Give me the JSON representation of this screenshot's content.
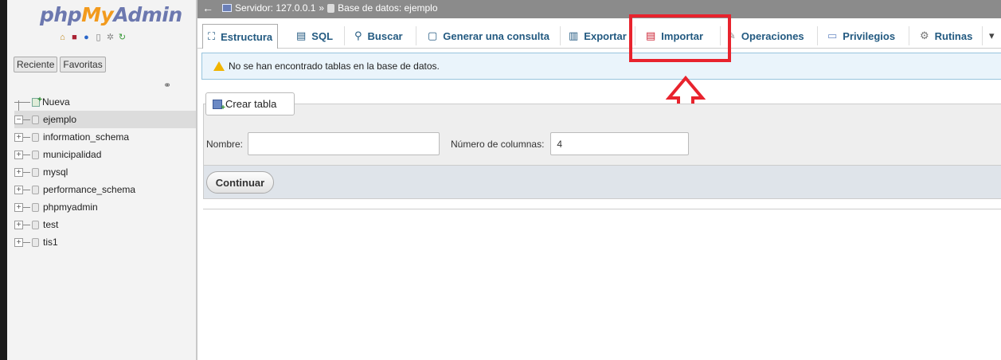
{
  "nav": {
    "logo": {
      "php": "php",
      "my": "My",
      "admin": "Admin"
    },
    "icons": [
      "home-icon",
      "exit-icon",
      "help-icon",
      "docs-icon",
      "settings-icon",
      "reload-icon"
    ],
    "tabs": [
      "Reciente",
      "Favoritas"
    ],
    "tree": [
      {
        "label": "Nueva",
        "kind": "new"
      },
      {
        "label": "ejemplo",
        "kind": "db",
        "expanded": true,
        "selected": true
      },
      {
        "label": "information_schema",
        "kind": "db"
      },
      {
        "label": "municipalidad",
        "kind": "db"
      },
      {
        "label": "mysql",
        "kind": "db"
      },
      {
        "label": "performance_schema",
        "kind": "db"
      },
      {
        "label": "phpmyadmin",
        "kind": "db"
      },
      {
        "label": "test",
        "kind": "db"
      },
      {
        "label": "tis1",
        "kind": "db"
      }
    ]
  },
  "breadcrumb": {
    "server": "Servidor: 127.0.0.1",
    "separator": "»",
    "database": "Base de datos: ejemplo"
  },
  "menu": {
    "structure": "Estructura",
    "sql": "SQL",
    "search": "Buscar",
    "query": "Generar una consulta",
    "export": "Exportar",
    "import": "Importar",
    "operations": "Operaciones",
    "privileges": "Privilegios",
    "routines": "Rutinas",
    "more": "▾"
  },
  "notice": {
    "text": "No se han encontrado tablas en la base de datos."
  },
  "create_table": {
    "title": "Crear tabla",
    "name_label": "Nombre:",
    "name_value": "",
    "columns_label": "Número de columnas:",
    "columns_value": "4",
    "continue": "Continuar"
  },
  "colors": {
    "highlight": "#e8232d",
    "link": "#235a81",
    "topbar": "#8b8b8b",
    "notice_bg": "#eaf4fb"
  }
}
